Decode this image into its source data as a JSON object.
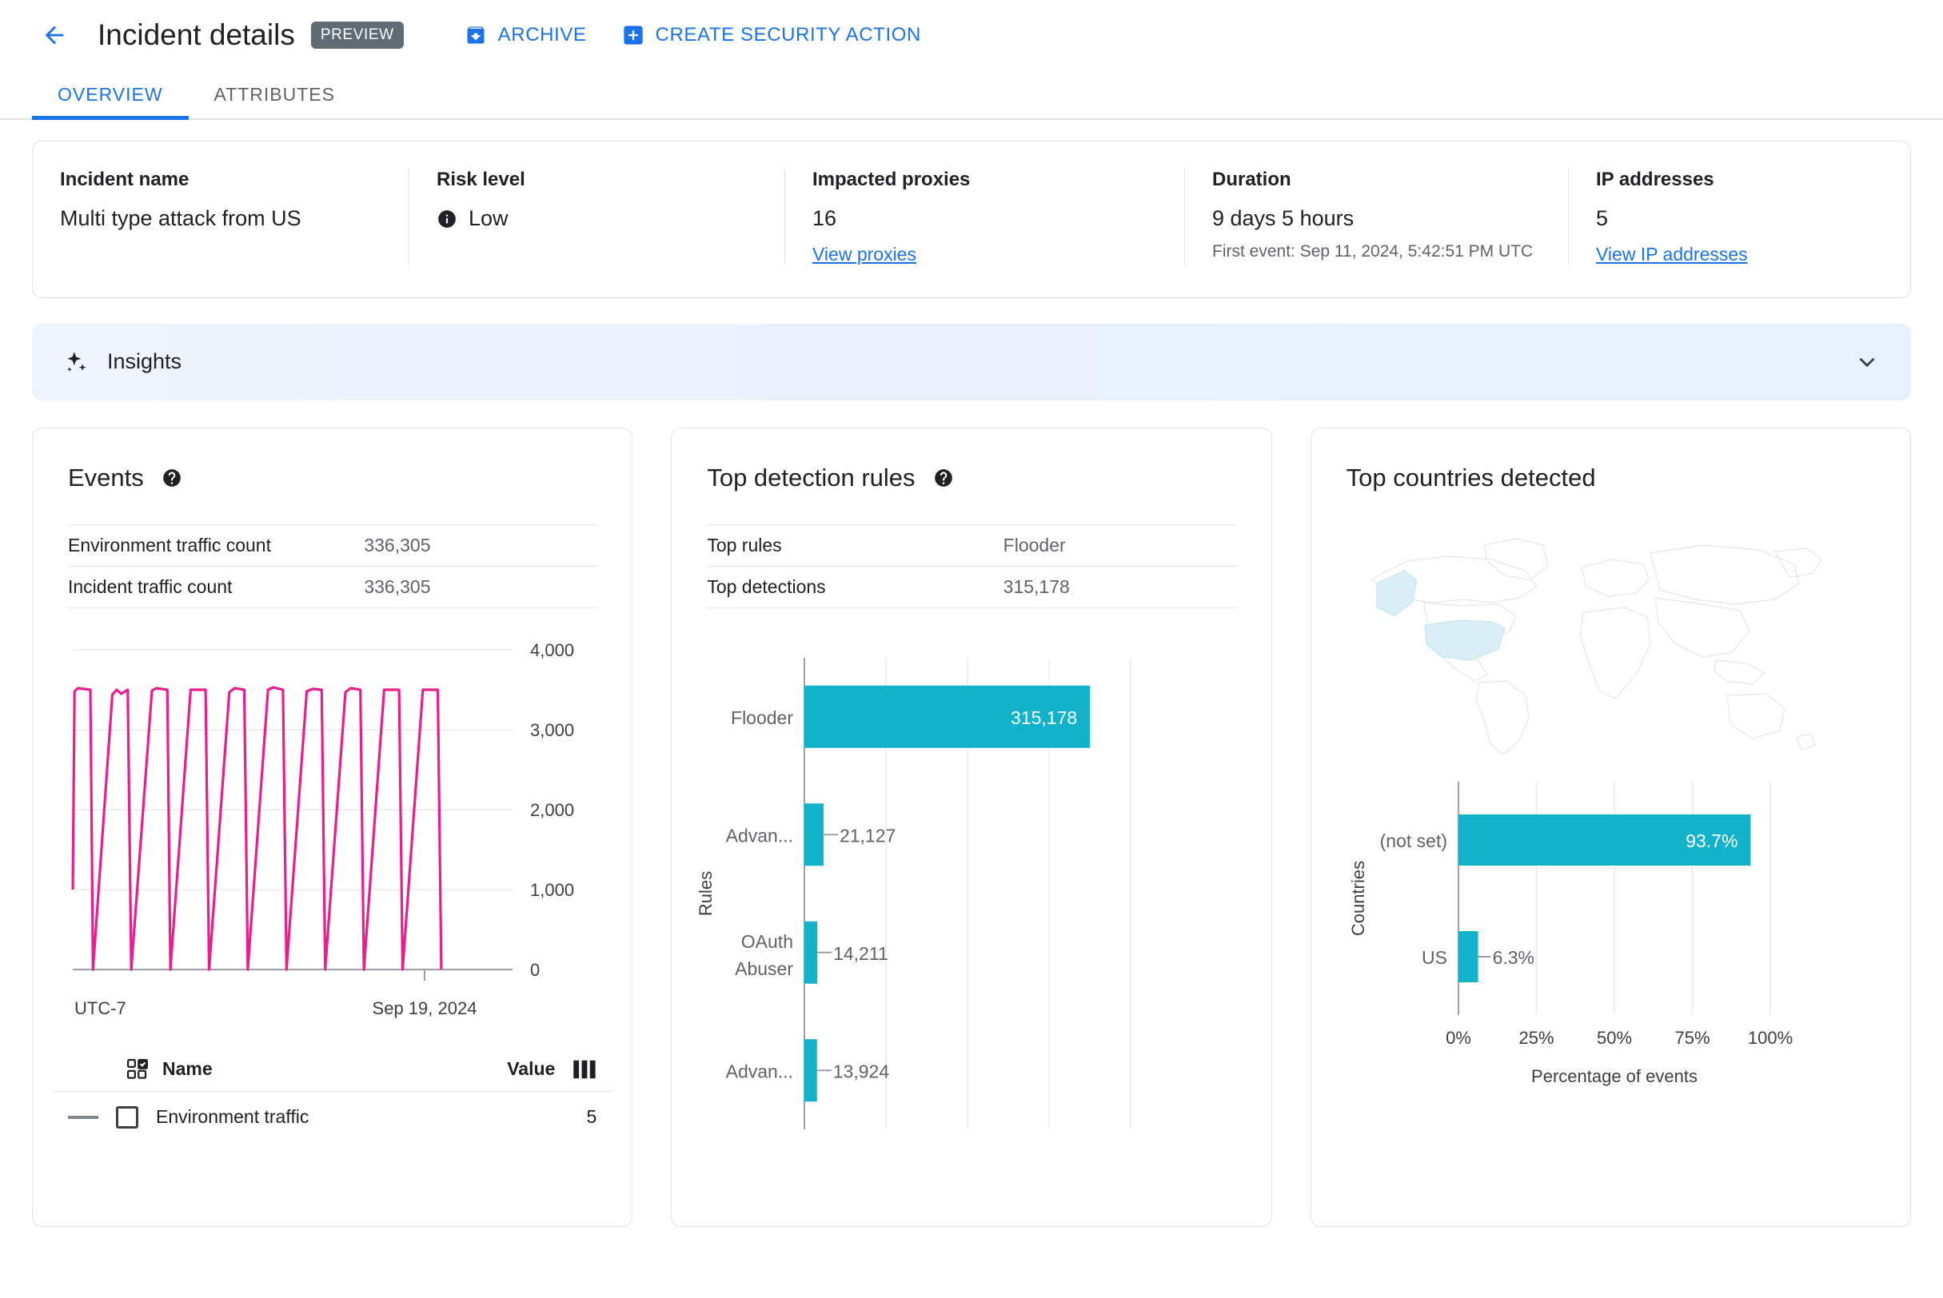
{
  "header": {
    "back_icon": "arrow-left-icon",
    "title": "Incident details",
    "preview_badge": "PREVIEW",
    "actions": [
      {
        "label": "ARCHIVE",
        "icon": "archive-icon"
      },
      {
        "label": "CREATE SECURITY ACTION",
        "icon": "plus-box-icon"
      }
    ]
  },
  "tabs": [
    {
      "label": "OVERVIEW",
      "active": true
    },
    {
      "label": "ATTRIBUTES",
      "active": false
    }
  ],
  "summary": {
    "incident_name": {
      "label": "Incident name",
      "value": "Multi type attack from US"
    },
    "risk_level": {
      "label": "Risk level",
      "value": "Low",
      "icon": "info-icon"
    },
    "impacted_proxies": {
      "label": "Impacted proxies",
      "value": "16",
      "link": "View proxies"
    },
    "duration": {
      "label": "Duration",
      "value": "9 days 5 hours",
      "sub": "First event: Sep 11, 2024, 5:42:51 PM UTC"
    },
    "ip_addresses": {
      "label": "IP addresses",
      "value": "5",
      "link": "View IP addresses"
    }
  },
  "insights": {
    "title": "Insights",
    "icon": "sparkle-icon",
    "chevron": "chevron-down-icon"
  },
  "events_card": {
    "title": "Events",
    "help_icon": "help-icon",
    "rows": [
      {
        "key": "Environment traffic count",
        "value": "336,305"
      },
      {
        "key": "Incident traffic count",
        "value": "336,305"
      }
    ],
    "legend": {
      "select_icon": "select-all-icon",
      "name_header": "Name",
      "value_header": "Value",
      "columns_icon": "columns-icon",
      "items": [
        {
          "name": "Environment traffic",
          "value": "5"
        }
      ]
    }
  },
  "rules_card": {
    "title": "Top detection rules",
    "help_icon": "help-icon",
    "rows": [
      {
        "key": "Top rules",
        "value": "Flooder"
      },
      {
        "key": "Top detections",
        "value": "315,178"
      }
    ]
  },
  "countries_card": {
    "title": "Top countries detected",
    "map_highlight_color": "#d9eef5",
    "map_stroke_color": "#e4e6e8"
  },
  "colors": {
    "accent_blue": "#1a73e8",
    "bar_teal": "#12b2cb",
    "line_pink": "#e91e8c",
    "badge_gray": "#5f6b74"
  },
  "chart_data": [
    {
      "type": "line",
      "name": "events-over-time",
      "title": "Events",
      "xlabel": "UTC-7",
      "ylabel": "",
      "ylim": [
        0,
        4000
      ],
      "yticks": [
        0,
        1000,
        2000,
        3000,
        4000
      ],
      "ytick_labels": [
        "0",
        "1,000",
        "2,000",
        "3,000",
        "4,000"
      ],
      "xtick_labels": [
        "UTC-7",
        "Sep 19, 2024"
      ],
      "series_color": "#e91e8c",
      "peak_value": 3500,
      "trough_value": 0,
      "cycles": 10,
      "points": [
        {
          "x": 0.0,
          "y": 1000
        },
        {
          "x": 0.004,
          "y": 3480
        },
        {
          "x": 0.012,
          "y": 3520
        },
        {
          "x": 0.04,
          "y": 3500
        },
        {
          "x": 0.046,
          "y": 0
        },
        {
          "x": 0.09,
          "y": 3440
        },
        {
          "x": 0.1,
          "y": 3500
        },
        {
          "x": 0.11,
          "y": 3450
        },
        {
          "x": 0.125,
          "y": 3500
        },
        {
          "x": 0.133,
          "y": 0
        },
        {
          "x": 0.18,
          "y": 3490
        },
        {
          "x": 0.19,
          "y": 3520
        },
        {
          "x": 0.215,
          "y": 3500
        },
        {
          "x": 0.222,
          "y": 0
        },
        {
          "x": 0.268,
          "y": 3500
        },
        {
          "x": 0.302,
          "y": 3500
        },
        {
          "x": 0.31,
          "y": 0
        },
        {
          "x": 0.356,
          "y": 3470
        },
        {
          "x": 0.368,
          "y": 3520
        },
        {
          "x": 0.39,
          "y": 3500
        },
        {
          "x": 0.398,
          "y": 0
        },
        {
          "x": 0.444,
          "y": 3500
        },
        {
          "x": 0.456,
          "y": 3530
        },
        {
          "x": 0.478,
          "y": 3500
        },
        {
          "x": 0.486,
          "y": 0
        },
        {
          "x": 0.532,
          "y": 3480
        },
        {
          "x": 0.545,
          "y": 3510
        },
        {
          "x": 0.566,
          "y": 3500
        },
        {
          "x": 0.574,
          "y": 0
        },
        {
          "x": 0.62,
          "y": 3470
        },
        {
          "x": 0.632,
          "y": 3520
        },
        {
          "x": 0.654,
          "y": 3500
        },
        {
          "x": 0.662,
          "y": 0
        },
        {
          "x": 0.708,
          "y": 3500
        },
        {
          "x": 0.742,
          "y": 3500
        },
        {
          "x": 0.75,
          "y": 0
        },
        {
          "x": 0.796,
          "y": 3500
        },
        {
          "x": 0.83,
          "y": 3500
        },
        {
          "x": 0.838,
          "y": 0
        }
      ]
    },
    {
      "type": "bar",
      "name": "top-detection-rules",
      "orientation": "horizontal",
      "title": "Top detection rules",
      "ylabel": "Rules",
      "xlabel": "",
      "categories": [
        "Flooder",
        "Advan...",
        "OAuth Abuser",
        "Advan..."
      ],
      "values": [
        315178,
        21127,
        14211,
        13924
      ],
      "value_labels": [
        "315,178",
        "21,127",
        "14,211",
        "13,924"
      ],
      "xlim": [
        0,
        360000
      ],
      "gridlines": 5,
      "bar_color": "#12b2cb"
    },
    {
      "type": "bar",
      "name": "top-countries-detected",
      "orientation": "horizontal",
      "title": "Top countries detected",
      "ylabel": "Countries",
      "xlabel": "Percentage of events",
      "categories": [
        "(not set)",
        "US"
      ],
      "values": [
        93.7,
        6.3
      ],
      "value_labels": [
        "93.7%",
        "6.3%"
      ],
      "xlim": [
        0,
        100
      ],
      "xticks": [
        0,
        25,
        50,
        75,
        100
      ],
      "xtick_labels": [
        "0%",
        "25%",
        "50%",
        "75%",
        "100%"
      ],
      "bar_color": "#12b2cb"
    }
  ]
}
